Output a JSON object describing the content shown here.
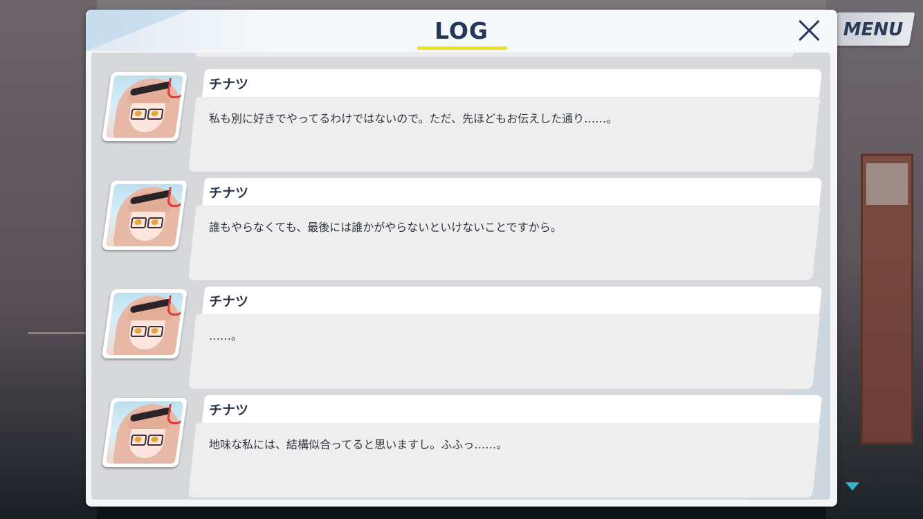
{
  "menu": {
    "label": "MENU"
  },
  "log": {
    "title": "LOG",
    "close_icon": "close-icon",
    "accent_color": "#f2e329",
    "entries": [
      {
        "name": "チナツ",
        "text": "私も別に好きでやってるわけではないので。ただ、先ほどもお伝えした通り……。",
        "avatar": "chinatsu-portrait"
      },
      {
        "name": "チナツ",
        "text": "誰もやらなくても、最後には誰かがやらないといけないことですから。",
        "avatar": "chinatsu-portrait"
      },
      {
        "name": "チナツ",
        "text": "……。",
        "avatar": "chinatsu-portrait"
      },
      {
        "name": "チナツ",
        "text": "地味な私には、結構似合ってると思いますし。ふふっ……。",
        "avatar": "chinatsu-portrait"
      }
    ]
  },
  "scroll_indicator": {
    "icon": "scroll-down-triangle-icon",
    "color": "#2fb7c9"
  }
}
